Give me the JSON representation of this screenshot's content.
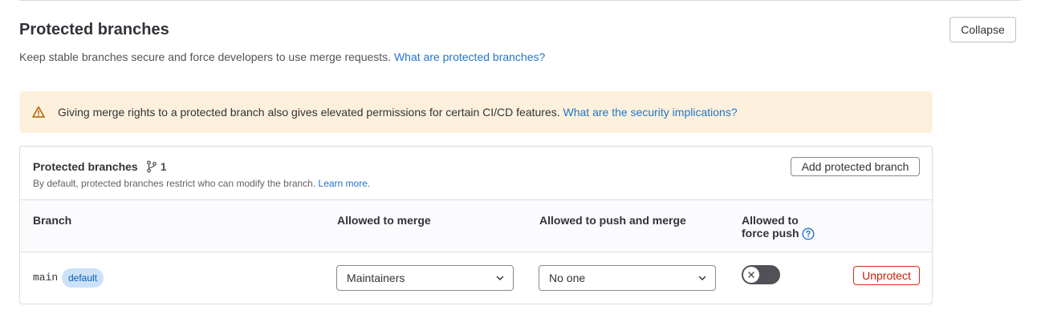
{
  "section": {
    "title": "Protected branches",
    "description": "Keep stable branches secure and force developers to use merge requests.",
    "help_link": "What are protected branches?",
    "collapse_label": "Collapse"
  },
  "alert": {
    "text": "Giving merge rights to a protected branch also gives elevated permissions for certain CI/CD features.",
    "link": "What are the security implications?",
    "icon": "warning-icon"
  },
  "card": {
    "title": "Protected branches",
    "count": "1",
    "subtitle": "By default, protected branches restrict who can modify the branch.",
    "learn_more": "Learn more.",
    "add_button": "Add protected branch"
  },
  "table": {
    "headers": {
      "branch": "Branch",
      "merge": "Allowed to merge",
      "push": "Allowed to push and merge",
      "force_line1": "Allowed to",
      "force_line2": "force push"
    },
    "rows": [
      {
        "branch": "main",
        "badge": "default",
        "merge": "Maintainers",
        "push": "No one",
        "force_push": false,
        "action": "Unprotect"
      }
    ]
  },
  "colors": {
    "link": "#1f75cb",
    "alert_bg": "#fdf1dd",
    "badge_bg": "#cbe2f9",
    "danger": "#dd2b0e"
  }
}
